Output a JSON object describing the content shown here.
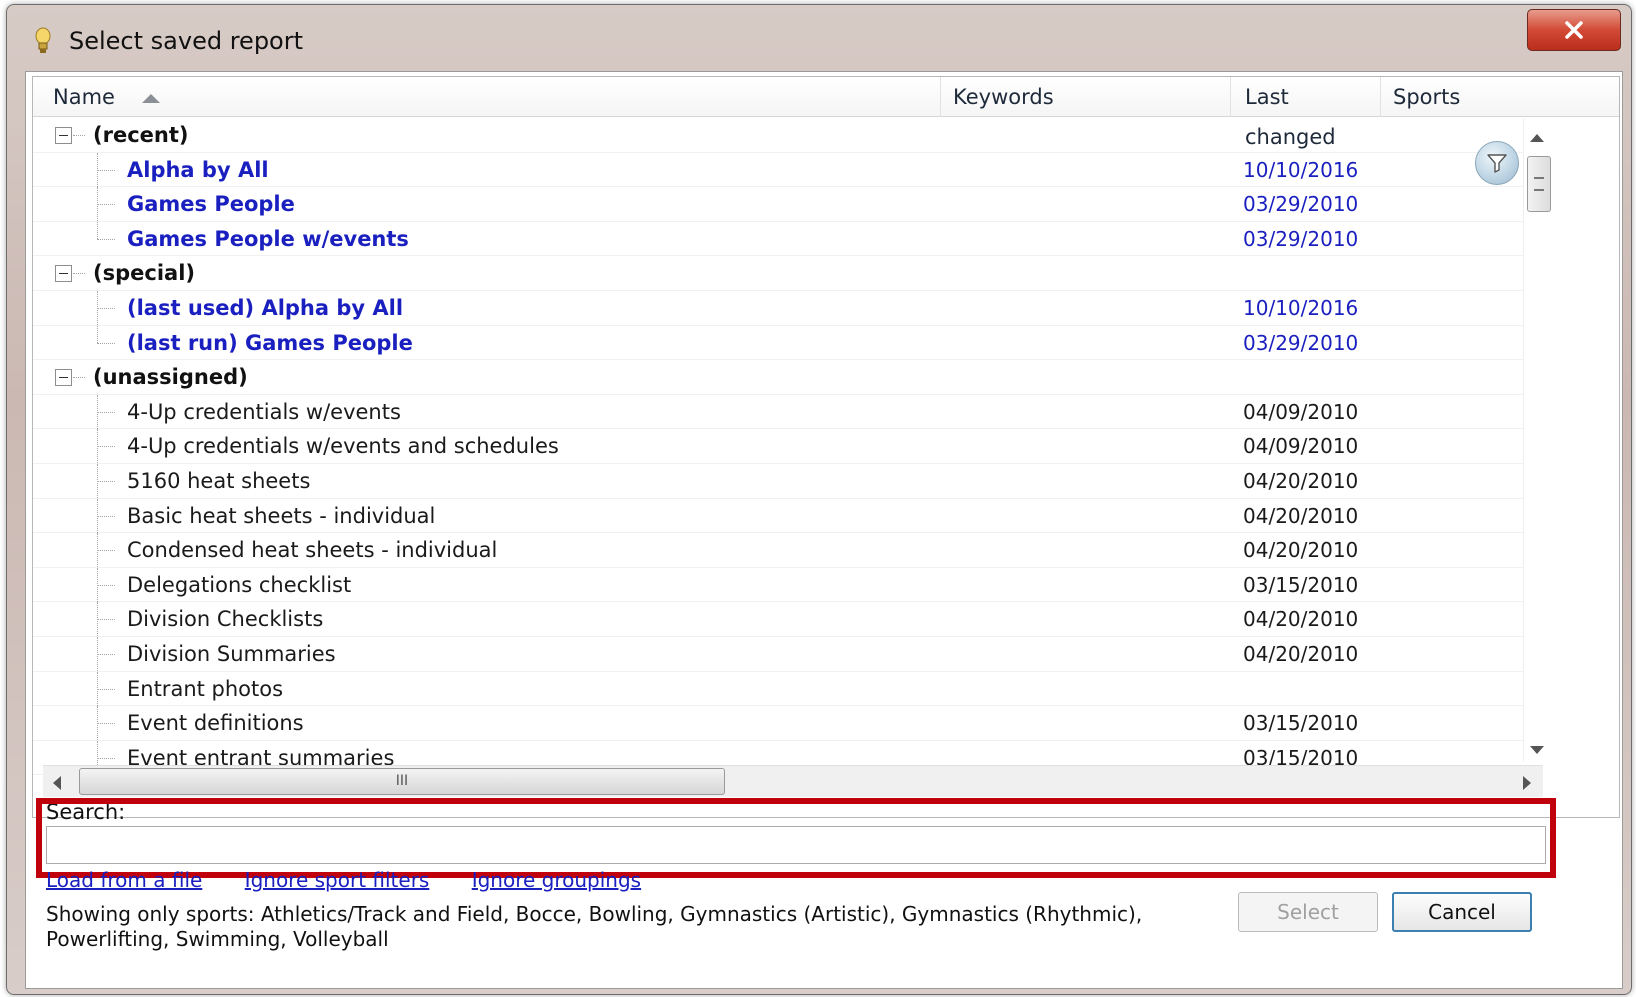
{
  "window": {
    "title": "Select saved report",
    "title_icon": "report-bulb-icon",
    "close_icon": "close-icon"
  },
  "columns": {
    "name": "Name",
    "keywords": "Keywords",
    "last_changed": "Last changed",
    "sports": "Sports"
  },
  "groups": [
    {
      "label": "(recent)",
      "items": [
        {
          "name": "Alpha by All",
          "date": "10/10/2016"
        },
        {
          "name": "Games People",
          "date": "03/29/2010"
        },
        {
          "name": "Games People w/events",
          "date": "03/29/2010"
        }
      ]
    },
    {
      "label": "(special)",
      "items": [
        {
          "name": "(last used) Alpha by All",
          "date": "10/10/2016"
        },
        {
          "name": "(last run) Games People",
          "date": "03/29/2010"
        }
      ]
    },
    {
      "label": "(unassigned)",
      "items": [
        {
          "name": "4-Up credentials w/events",
          "date": "04/09/2010"
        },
        {
          "name": "4-Up credentials w/events and schedules",
          "date": "04/09/2010"
        },
        {
          "name": "5160 heat sheets",
          "date": "04/20/2010"
        },
        {
          "name": "Basic heat sheets - individual",
          "date": "04/20/2010"
        },
        {
          "name": "Condensed heat sheets - individual",
          "date": "04/20/2010"
        },
        {
          "name": "Delegations checklist",
          "date": "03/15/2010"
        },
        {
          "name": "Division Checklists",
          "date": "04/20/2010"
        },
        {
          "name": "Division Summaries",
          "date": "04/20/2010"
        },
        {
          "name": "Entrant photos",
          "date": ""
        },
        {
          "name": "Event definitions",
          "date": "03/15/2010"
        },
        {
          "name": "Event entrant summaries",
          "date": "03/15/2010"
        }
      ]
    }
  ],
  "hscroll_grip": "III",
  "search": {
    "label": "Search:",
    "value": "",
    "placeholder": ""
  },
  "links": {
    "load": "Load from a file",
    "ignore_sport": "Ignore sport filters",
    "ignore_groupings": "Ignore groupings"
  },
  "status": "Showing only sports: Athletics/Track and Field, Bocce, Bowling, Gymnastics (Artistic), Gymnastics (Rhythmic), Powerlifting, Swimming, Volleyball",
  "buttons": {
    "select": "Select",
    "cancel": "Cancel"
  },
  "colors": {
    "link_blue": "#1a1fbf",
    "highlight_red": "#c0000a",
    "close_red": "#d24a35"
  }
}
